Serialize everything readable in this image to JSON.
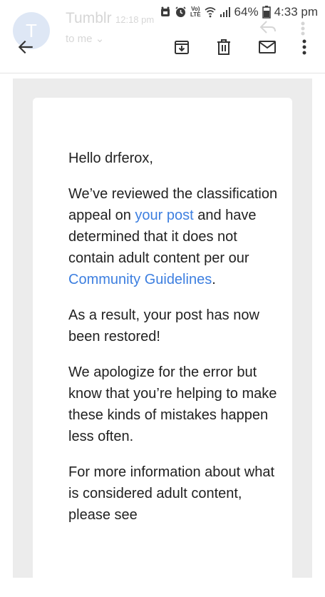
{
  "status_bar": {
    "battery": "64%",
    "time": "4:33 pm"
  },
  "header": {
    "sender": "Tumblr",
    "time": "12:18 pm",
    "recipient": "to me",
    "avatar_letter": "T"
  },
  "message": {
    "greeting": "Hello drferox,",
    "p1": {
      "before_link1": "We’ve reviewed the classification appeal on ",
      "link1": "your post",
      "between": " and have determined that it does not contain adult content per our ",
      "link2": "Community Guidelines",
      "after": "."
    },
    "p2": "As a result, your post has now been restored!",
    "p3": "We apologize for the error but know that you’re helping to make these kinds of mistakes happen less often.",
    "p4": "For more information about what is considered adult content, please see"
  },
  "icons": {
    "back": "arrow-back-icon",
    "archive": "archive-icon",
    "delete": "trash-icon",
    "mark_unread": "mail-icon",
    "more": "more-vertical-icon"
  },
  "colors": {
    "link": "#3d7fe0",
    "avatar": "#3b6fc4",
    "background": "#ececec"
  }
}
